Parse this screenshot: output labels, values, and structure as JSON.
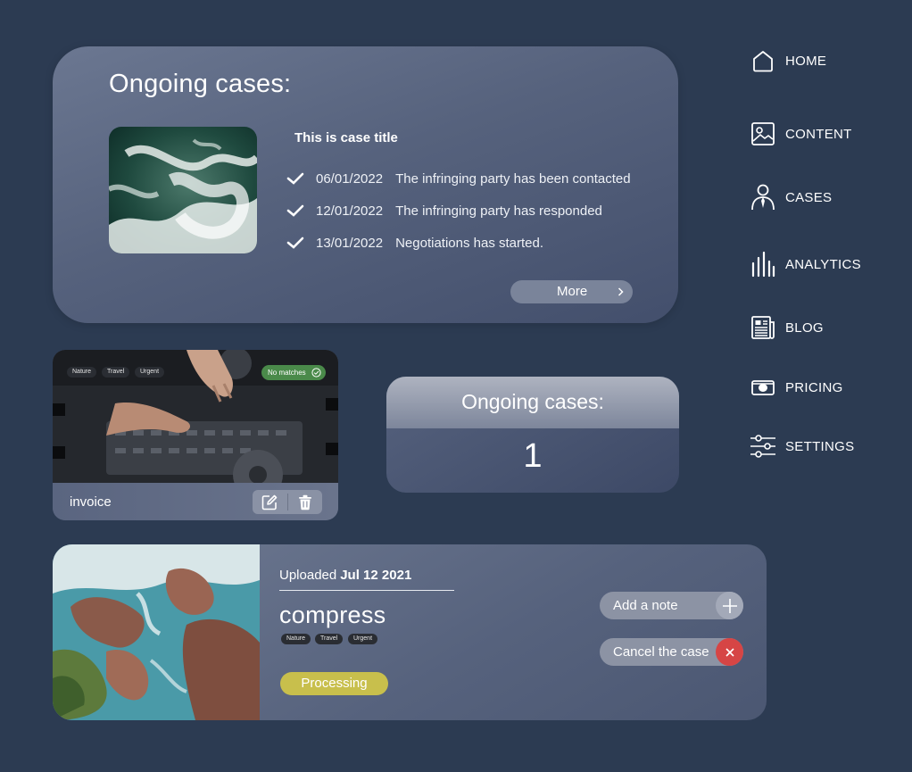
{
  "ongoing": {
    "title": "Ongoing cases:",
    "case_title": "This is case title",
    "events": [
      {
        "date": "06/01/2022",
        "text": "The infringing party has been contacted"
      },
      {
        "date": "12/01/2022",
        "text": "The infringing party has responded"
      },
      {
        "date": "13/01/2022",
        "text": "Negotiations has started."
      }
    ],
    "more_label": "More"
  },
  "media": {
    "tags": [
      "Nature",
      "Travel",
      "Urgent"
    ],
    "match_status": "No matches",
    "name": "invoice",
    "edit_icon": "edit-icon",
    "delete_icon": "trash-icon"
  },
  "counter": {
    "title": "Ongoing cases:",
    "value": "1"
  },
  "upload": {
    "uploaded_label": "Uploaded",
    "uploaded_date": "Jul 12 2021",
    "file_name": "compress",
    "tags": [
      "Nature",
      "Travel",
      "Urgent"
    ],
    "status": "Processing",
    "add_note_label": "Add a note",
    "cancel_label": "Cancel the case"
  },
  "nav": {
    "items": [
      {
        "label": "HOME",
        "icon": "home-icon"
      },
      {
        "label": "CONTENT",
        "icon": "image-icon"
      },
      {
        "label": "CASES",
        "icon": "person-icon"
      },
      {
        "label": "ANALYTICS",
        "icon": "bar-chart-icon"
      },
      {
        "label": "BLOG",
        "icon": "newspaper-icon"
      },
      {
        "label": "PRICING",
        "icon": "money-icon"
      },
      {
        "label": "SETTINGS",
        "icon": "sliders-icon"
      }
    ]
  },
  "colors": {
    "background": "#2c3b52",
    "processing": "#c8bf4c",
    "cancel": "#d64545",
    "match": "#4a8a4a"
  }
}
